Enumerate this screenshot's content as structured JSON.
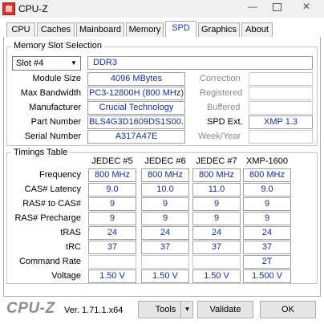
{
  "window": {
    "title": "CPU-Z"
  },
  "tabs": [
    {
      "label": "CPU"
    },
    {
      "label": "Caches"
    },
    {
      "label": "Mainboard"
    },
    {
      "label": "Memory"
    },
    {
      "label": "SPD"
    },
    {
      "label": "Graphics"
    },
    {
      "label": "About"
    }
  ],
  "active_tab": "SPD",
  "memory_slot": {
    "group_title": "Memory Slot Selection",
    "slot_selected": "Slot #4",
    "type": "DDR3",
    "labels": {
      "module_size": "Module Size",
      "max_bandwidth": "Max Bandwidth",
      "manufacturer": "Manufacturer",
      "part_number": "Part Number",
      "serial_number": "Serial Number",
      "correction": "Correction",
      "registered": "Registered",
      "buffered": "Buffered",
      "spd_ext": "SPD Ext.",
      "week_year": "Week/Year"
    },
    "values": {
      "module_size": "4096 MBytes",
      "max_bandwidth": "PC3-12800H (800 MHz)",
      "manufacturer": "Crucial Technology",
      "part_number": "BLS4G3D1609DS1S00.",
      "serial_number": "A317A47E",
      "spd_ext": "XMP 1.3"
    }
  },
  "timings": {
    "group_title": "Timings Table",
    "columns": [
      "JEDEC #5",
      "JEDEC #6",
      "JEDEC #7",
      "XMP-1600"
    ],
    "rows": [
      {
        "label": "Frequency",
        "values": [
          "800 MHz",
          "800 MHz",
          "800 MHz",
          "800 MHz"
        ]
      },
      {
        "label": "CAS# Latency",
        "values": [
          "9.0",
          "10.0",
          "11.0",
          "9.0"
        ]
      },
      {
        "label": "RAS# to CAS#",
        "values": [
          "9",
          "9",
          "9",
          "9"
        ]
      },
      {
        "label": "RAS# Precharge",
        "values": [
          "9",
          "9",
          "9",
          "9"
        ]
      },
      {
        "label": "tRAS",
        "values": [
          "24",
          "24",
          "24",
          "24"
        ]
      },
      {
        "label": "tRC",
        "values": [
          "37",
          "37",
          "37",
          "37"
        ]
      },
      {
        "label": "Command Rate",
        "values": [
          "",
          "",
          "",
          "2T"
        ]
      },
      {
        "label": "Voltage",
        "values": [
          "1.50 V",
          "1.50 V",
          "1.50 V",
          "1.500 V"
        ]
      }
    ]
  },
  "footer": {
    "logo": "CPU-Z",
    "version": "Ver. 1.71.1.x64",
    "tools_label": "Tools",
    "validate_label": "Validate",
    "ok_label": "OK"
  }
}
